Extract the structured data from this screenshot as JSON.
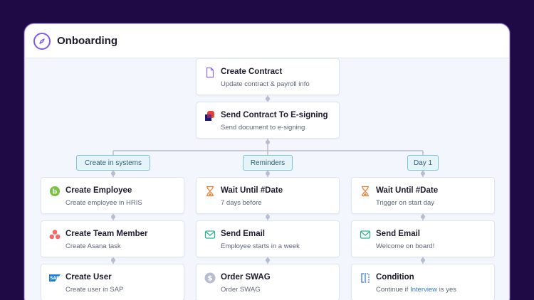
{
  "header": {
    "title": "Onboarding",
    "logo_icon": "compass-icon"
  },
  "colors": {
    "background": "#1f0a45",
    "accent": "#7e5bef",
    "tag_border": "#7fc3d3",
    "connector": "#b8bed0"
  },
  "top_steps": [
    {
      "title": "Create Contract",
      "subtitle": "Update contract & payroll info",
      "icon": "document-icon"
    },
    {
      "title": "Send Contract To E-signing",
      "subtitle": "Send document to e-signing",
      "icon": "esign-logo-icon"
    }
  ],
  "branches": [
    {
      "tag": "Create in systems",
      "steps": [
        {
          "title": "Create Employee",
          "subtitle": "Create employee in HRIS",
          "icon": "hris-logo-icon"
        },
        {
          "title": "Create Team Member",
          "subtitle": "Create Asana task",
          "icon": "asana-logo-icon"
        },
        {
          "title": "Create User",
          "subtitle": "Create user in SAP",
          "icon": "sap-logo-icon"
        }
      ]
    },
    {
      "tag": "Reminders",
      "steps": [
        {
          "title": "Wait Until #Date",
          "subtitle": "7 days before",
          "icon": "hourglass-icon"
        },
        {
          "title": "Send Email",
          "subtitle": "Employee starts in a week",
          "icon": "envelope-icon"
        },
        {
          "title": "Order SWAG",
          "subtitle": "Order SWAG",
          "icon": "dollar-icon"
        }
      ]
    },
    {
      "tag": "Day 1",
      "steps": [
        {
          "title": "Wait Until #Date",
          "subtitle": "Trigger on start day",
          "icon": "hourglass-icon"
        },
        {
          "title": "Send Email",
          "subtitle": "Welcome on board!",
          "icon": "envelope-icon"
        },
        {
          "title": "Condition",
          "subtitle_before": "Continue if",
          "subtitle_link": "Interview",
          "subtitle_after": "is yes",
          "icon": "condition-icon"
        }
      ]
    }
  ]
}
